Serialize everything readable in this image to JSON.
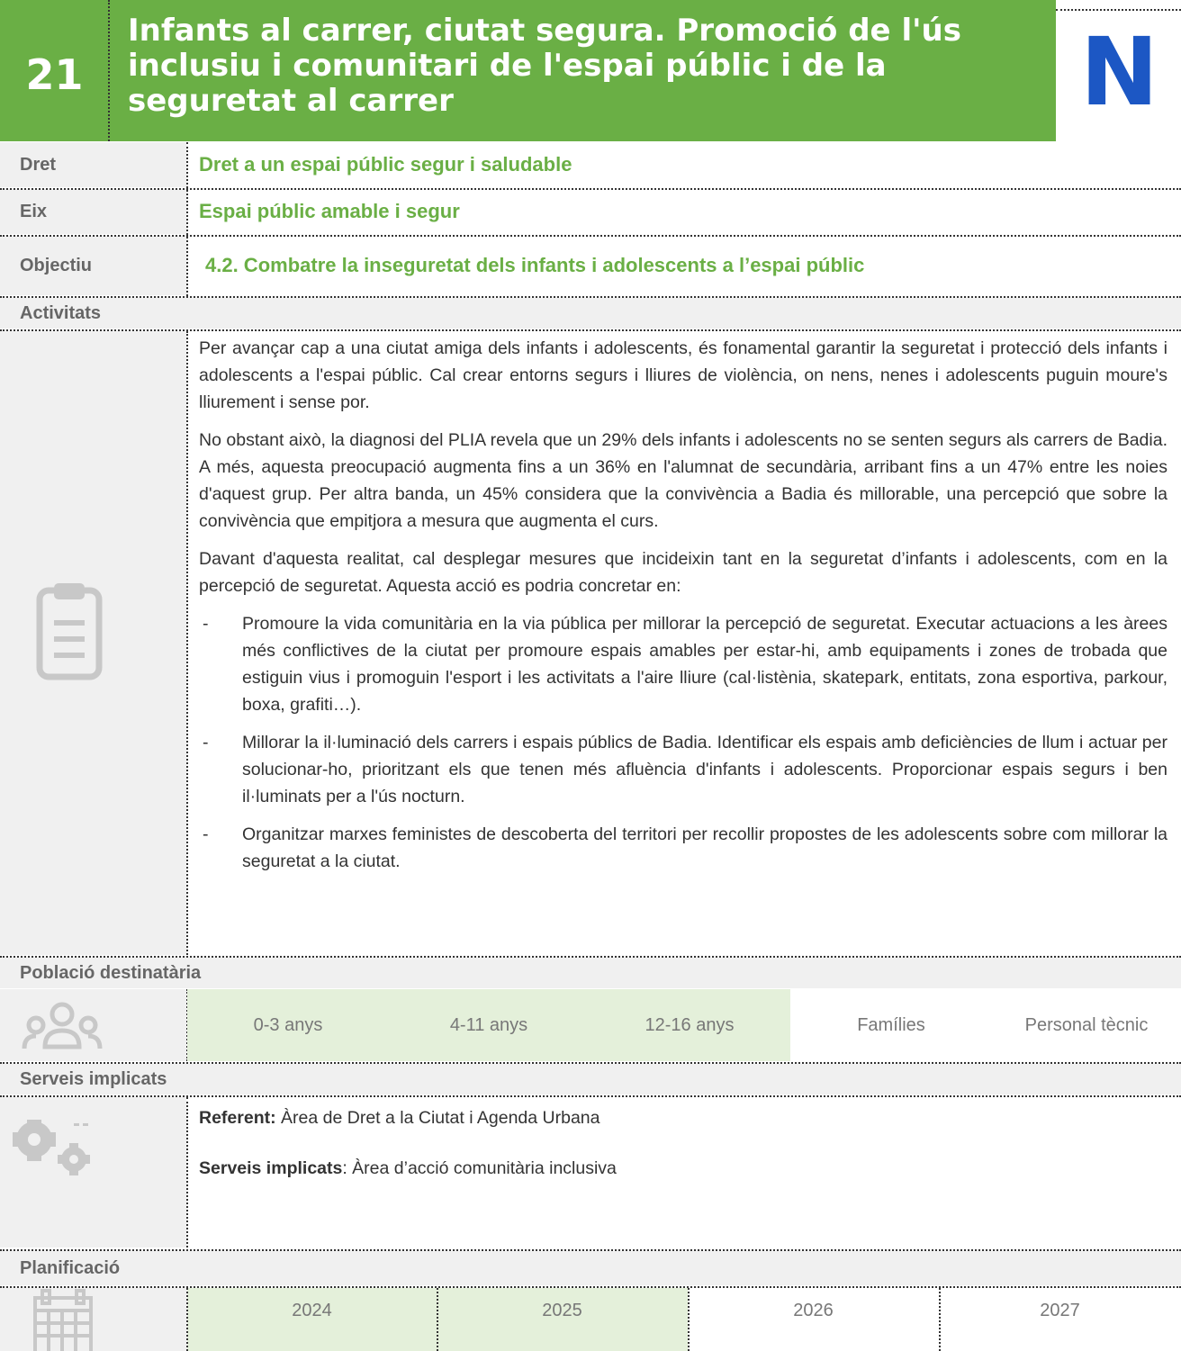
{
  "header": {
    "number": "21",
    "title": "Infants al carrer, ciutat segura. Promoció de l'ús inclusiu i comunitari de l'espai públic i de la seguretat al carrer",
    "badge": "N",
    "accent_color": "#6aaf45",
    "badge_color": "#1c57c4"
  },
  "rows": {
    "dret": {
      "label": "Dret",
      "value": "Dret a un espai públic segur i saludable"
    },
    "eix": {
      "label": "Eix",
      "value": "Espai públic amable i segur"
    },
    "objectiu": {
      "label": "Objectiu",
      "value": "4.2. Combatre la inseguretat dels infants i adolescents a l’espai públic"
    }
  },
  "activitats": {
    "label": "Activitats",
    "icon": "clipboard-icon",
    "paragraphs": [
      "Per avançar cap a una ciutat amiga dels infants i adolescents, és fonamental garantir la seguretat i protecció dels infants i adolescents a l'espai públic. Cal crear entorns segurs i lliures de violència, on nens, nenes i adolescents puguin moure's lliurement i sense por.",
      "No obstant això, la diagnosi del PLIA revela que un 29% dels infants i adolescents no se senten segurs als carrers de Badia. A més, aquesta preocupació augmenta fins a un 36% en l'alumnat de secundària, arribant fins a un 47% entre les noies d'aquest grup. Per altra banda, un 45% considera que la convivència a Badia és millorable, una percepció que sobre la convivència que empitjora a mesura que augmenta el curs.",
      "Davant d'aquesta realitat, cal desplegar mesures que incideixin tant en la seguretat d’infants i adolescents, com en la percepció de seguretat. Aquesta acció es podria concretar en:"
    ],
    "bullet_marker": "-",
    "bullets": [
      "Promoure la vida comunitària en la via pública per millorar la percepció de seguretat. Executar actuacions a les àrees més conflictives de la ciutat per promoure espais amables per estar-hi, amb equipaments i zones de trobada que estiguin vius i promoguin l'esport i les activitats a l'aire lliure (cal·listènia, skatepark, entitats, zona esportiva, parkour, boxa, grafiti…).",
      "Millorar la il·luminació dels carrers i espais públics de Badia. Identificar els espais amb deficiències de llum i actuar per solucionar-ho, prioritzant els que tenen més afluència d'infants i adolescents. Proporcionar espais segurs i ben il·luminats per a l'ús nocturn.",
      "Organitzar marxes feministes de descoberta del territori per recollir propostes de les adolescents sobre com millorar la seguretat a la ciutat."
    ]
  },
  "poblacio": {
    "label": "Població destinatària",
    "icon": "people-icon",
    "groups": [
      {
        "label": "0-3 anys",
        "selected": true
      },
      {
        "label": "4-11 anys",
        "selected": true
      },
      {
        "label": "12-16 anys",
        "selected": true
      },
      {
        "label": "Famílies",
        "selected": false
      },
      {
        "label": "Personal tècnic",
        "selected": false
      }
    ],
    "selected_color": "#e4f0da"
  },
  "serveis": {
    "label": "Serveis implicats",
    "icon": "gears-icon",
    "referent_label": "Referent:",
    "referent_value": " Àrea de Dret a la Ciutat i Agenda Urbana",
    "serveis_label": "Serveis implicats",
    "serveis_value": ": Àrea d’acció comunitària inclusiva"
  },
  "planificacio": {
    "label": "Planificació",
    "icon": "calendar-icon",
    "years": [
      {
        "label": "2024",
        "selected": true
      },
      {
        "label": "2025",
        "selected": true
      },
      {
        "label": "2026",
        "selected": false
      },
      {
        "label": "2027",
        "selected": false
      }
    ]
  }
}
